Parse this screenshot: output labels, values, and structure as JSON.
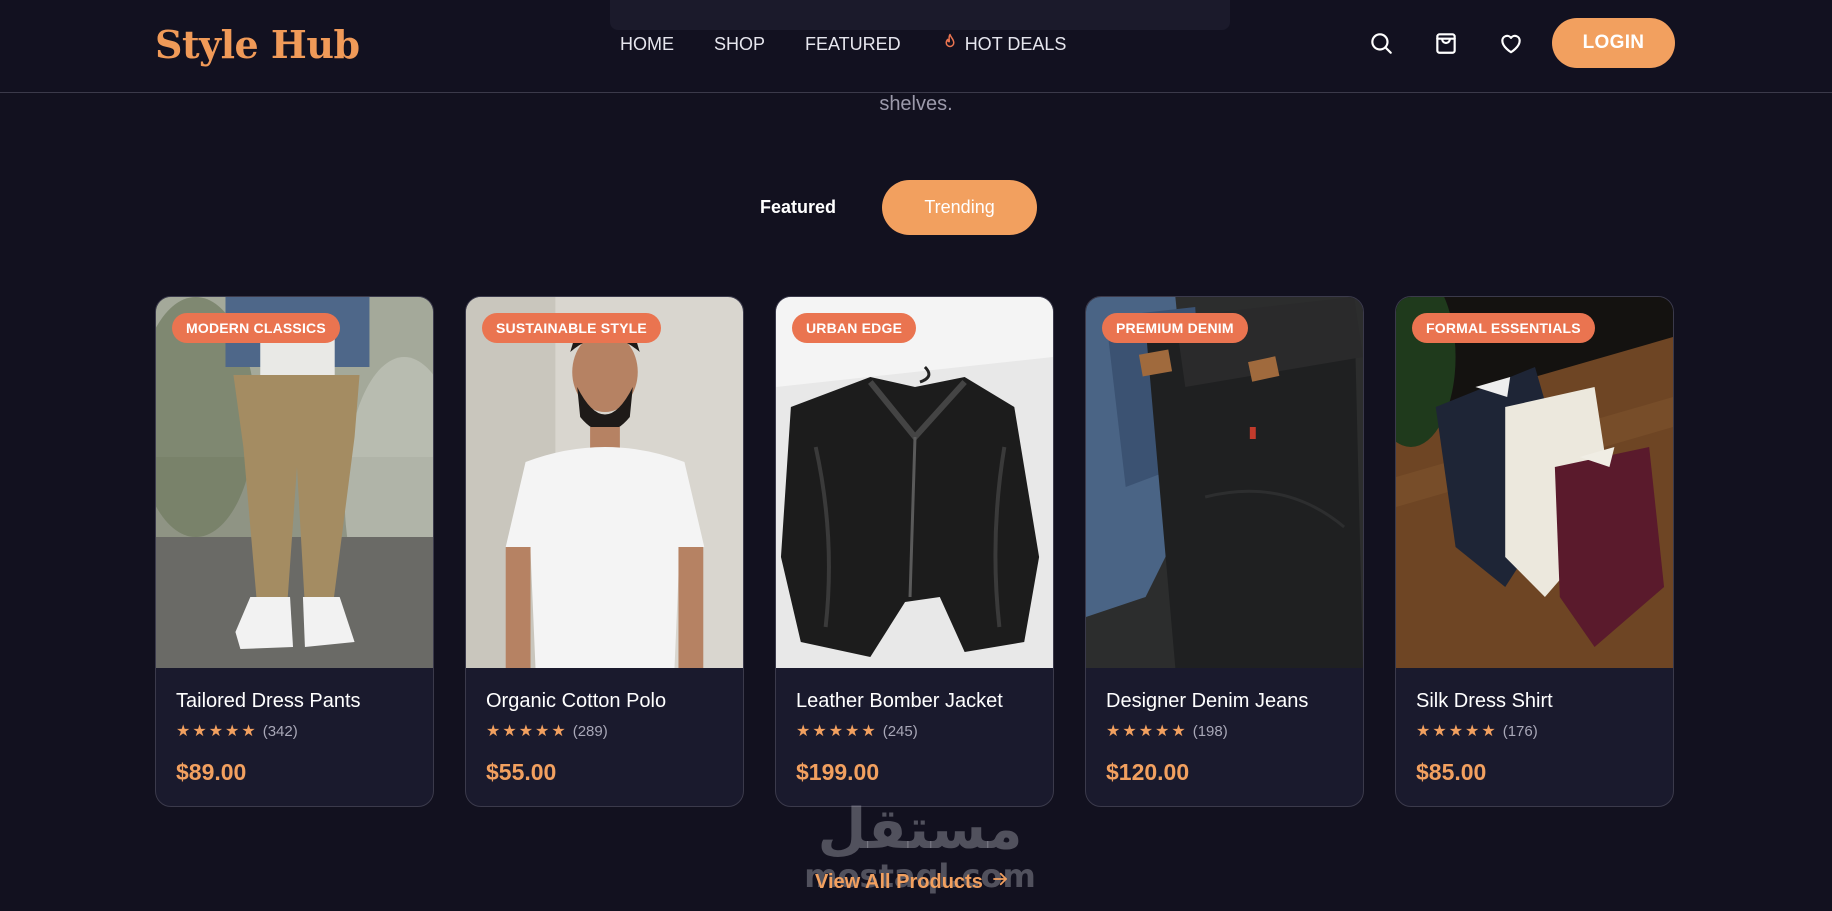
{
  "header": {
    "logo": "Style Hub",
    "nav": [
      {
        "label": "HOME"
      },
      {
        "label": "SHOP"
      },
      {
        "label": "FEATURED"
      },
      {
        "label": "HOT DEALS",
        "icon": "flame-icon"
      }
    ],
    "icons": [
      "search-icon",
      "shopping-bag-icon",
      "heart-icon"
    ],
    "login_label": "LOGIN"
  },
  "intro": {
    "subtitle_tail": "shelves."
  },
  "tabs": [
    {
      "label": "Featured",
      "active": false
    },
    {
      "label": "Trending",
      "active": true
    }
  ],
  "products": [
    {
      "badge": "MODERN CLASSICS",
      "title": "Tailored Dress Pants",
      "stars": "★★★★★",
      "reviews": "(342)",
      "price": "$89.00"
    },
    {
      "badge": "SUSTAINABLE STYLE",
      "title": "Organic Cotton Polo",
      "stars": "★★★★★",
      "reviews": "(289)",
      "price": "$55.00"
    },
    {
      "badge": "URBAN EDGE",
      "title": "Leather Bomber Jacket",
      "stars": "★★★★★",
      "reviews": "(245)",
      "price": "$199.00"
    },
    {
      "badge": "PREMIUM DENIM",
      "title": "Designer Denim Jeans",
      "stars": "★★★★★",
      "reviews": "(198)",
      "price": "$120.00"
    },
    {
      "badge": "FORMAL ESSENTIALS",
      "title": "Silk Dress Shirt",
      "stars": "★★★★★",
      "reviews": "(176)",
      "price": "$85.00"
    }
  ],
  "watermark": {
    "arabic": "مستقل",
    "latin": "mostaql.com"
  },
  "view_all_label": "View All Products",
  "colors": {
    "background": "#12111f",
    "accent": "#f2a05f",
    "badge": "#ea7450",
    "card": "#1a1a2d"
  }
}
